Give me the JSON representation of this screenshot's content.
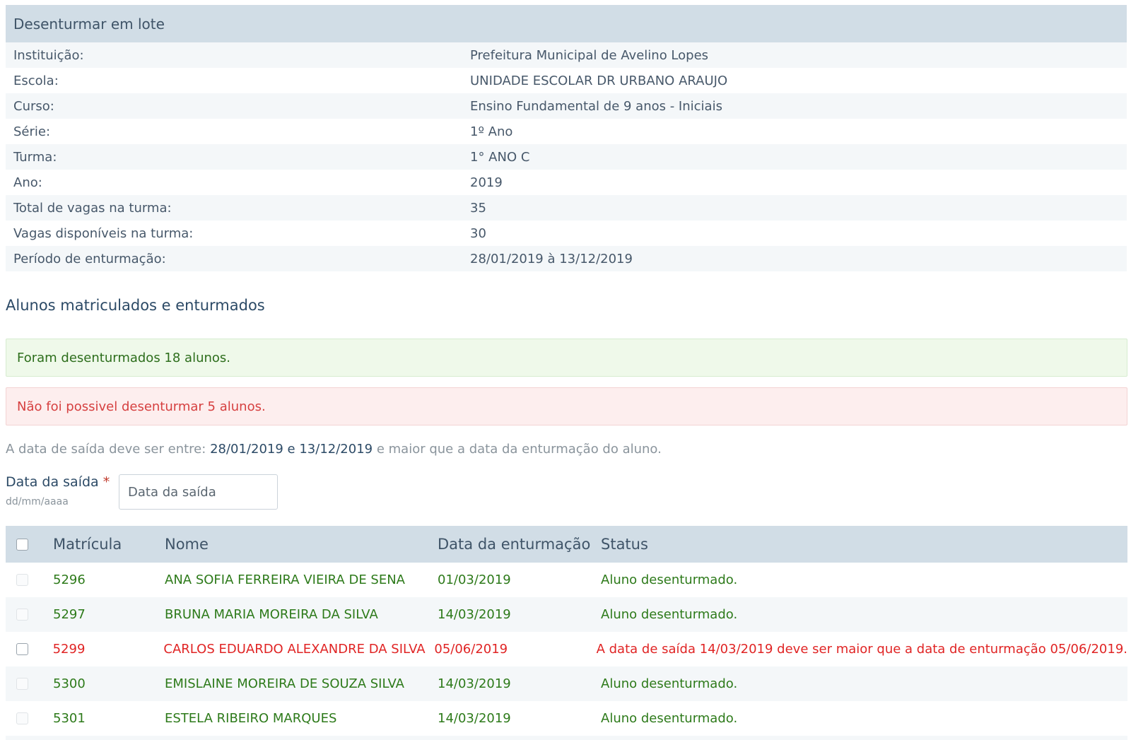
{
  "panel": {
    "title": "Desenturmar em lote",
    "rows": [
      {
        "label": "Instituição:",
        "value": "Prefeitura Municipal de Avelino Lopes"
      },
      {
        "label": "Escola:",
        "value": "UNIDADE ESCOLAR DR URBANO ARAUJO"
      },
      {
        "label": "Curso:",
        "value": "Ensino Fundamental de 9 anos - Iniciais"
      },
      {
        "label": "Série:",
        "value": "1º Ano"
      },
      {
        "label": "Turma:",
        "value": "1° ANO C"
      },
      {
        "label": "Ano:",
        "value": "2019"
      },
      {
        "label": "Total de vagas na turma:",
        "value": "35"
      },
      {
        "label": "Vagas disponíveis na turma:",
        "value": "30"
      },
      {
        "label": "Período de enturmação:",
        "value": "28/01/2019 à 13/12/2019"
      }
    ]
  },
  "section_title": "Alunos matriculados e enturmados",
  "alerts": {
    "success": "Foram desenturmados 18 alunos.",
    "error": "Não foi possivel desenturmar 5 alunos."
  },
  "hint": {
    "prefix": "A data de saída deve ser entre:",
    "start": "28/01/2019",
    "conj": "e",
    "end": "13/12/2019",
    "suffix": "e maior que a data da enturmação do aluno."
  },
  "exit_date_field": {
    "label": "Data da saída",
    "required_mark": "*",
    "help": "dd/mm/aaaa",
    "placeholder": "Data da saída",
    "value": ""
  },
  "table": {
    "headers": {
      "matricula": "Matrícula",
      "nome": "Nome",
      "data": "Data da enturmação",
      "status": "Status"
    },
    "rows": [
      {
        "matricula": "5296",
        "nome": "ANA SOFIA FERREIRA VIEIRA DE SENA",
        "data": "01/03/2019",
        "status": "Aluno desenturmado."
      },
      {
        "matricula": "5297",
        "nome": "BRUNA MARIA MOREIRA DA SILVA",
        "data": "14/03/2019",
        "status": "Aluno desenturmado."
      },
      {
        "matricula": "5299",
        "nome": "CARLOS EDUARDO ALEXANDRE DA SILVA",
        "data": "05/06/2019",
        "status": "A data de saída 14/03/2019 deve ser maior que a data de enturmação 05/06/2019."
      },
      {
        "matricula": "5300",
        "nome": "EMISLAINE MOREIRA DE SOUZA SILVA",
        "data": "14/03/2019",
        "status": "Aluno desenturmado."
      },
      {
        "matricula": "5301",
        "nome": "ESTELA RIBEIRO MARQUES",
        "data": "14/03/2019",
        "status": "Aluno desenturmado."
      }
    ]
  },
  "colors": {
    "header_bg": "#d1dde6",
    "success_text": "#2d7a1a",
    "error_text": "#e02424",
    "success_bg": "#eff9ea",
    "error_bg": "#fdeeee"
  }
}
